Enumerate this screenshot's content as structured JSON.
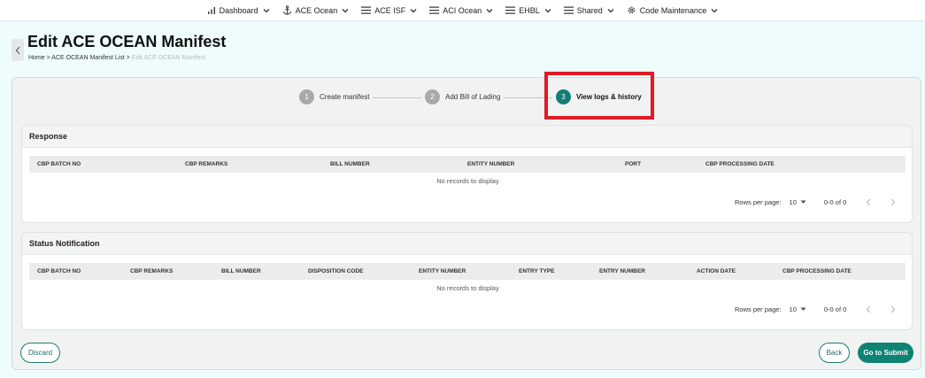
{
  "nav": {
    "items": [
      {
        "label": "Dashboard",
        "icon": "bar-chart-icon"
      },
      {
        "label": "ACE Ocean",
        "icon": "anchor-icon"
      },
      {
        "label": "ACE ISF",
        "icon": "menu-icon"
      },
      {
        "label": "ACI Ocean",
        "icon": "menu-icon"
      },
      {
        "label": "EHBL",
        "icon": "menu-icon"
      },
      {
        "label": "Shared",
        "icon": "menu-icon"
      },
      {
        "label": "Code Maintenance",
        "icon": "gear-icon"
      }
    ]
  },
  "header": {
    "title": "Edit ACE OCEAN Manifest",
    "breadcrumb": {
      "home": "Home",
      "list": "ACE OCEAN Manifest List",
      "current": "Edit ACE OCEAN Manifest",
      "separator": ">"
    }
  },
  "stepper": {
    "steps": [
      {
        "number": "1",
        "label": "Create manifest",
        "state": "inactive"
      },
      {
        "number": "2",
        "label": "Add Bill of Lading",
        "state": "inactive"
      },
      {
        "number": "3",
        "label": "View logs & history",
        "state": "active"
      }
    ]
  },
  "response": {
    "title": "Response",
    "columns": [
      "CBP BATCH NO",
      "CBP REMARKS",
      "BILL NUMBER",
      "ENTITY NUMBER",
      "PORT",
      "CBP PROCESSING DATE"
    ],
    "empty_text": "No records to display",
    "pagination": {
      "rows_label": "Rows per page:",
      "rows_value": "10",
      "range": "0-0 of 0"
    }
  },
  "status": {
    "title": "Status Notification",
    "columns": [
      "CBP BATCH NO",
      "CBP REMARKS",
      "BILL NUMBER",
      "DISPOSITION CODE",
      "ENTITY NUMBER",
      "ENTRY TYPE",
      "ENTRY NUMBER",
      "ACTION DATE",
      "CBP PROCESSING DATE"
    ],
    "empty_text": "No records to display",
    "pagination": {
      "rows_label": "Rows per page:",
      "rows_value": "10",
      "range": "0-0 of 0"
    }
  },
  "actions": {
    "discard": "Discard",
    "back": "Back",
    "submit": "Go to Submit"
  },
  "colors": {
    "accent": "#137e73",
    "highlight": "#e01b24",
    "background": "#eefcfc"
  }
}
